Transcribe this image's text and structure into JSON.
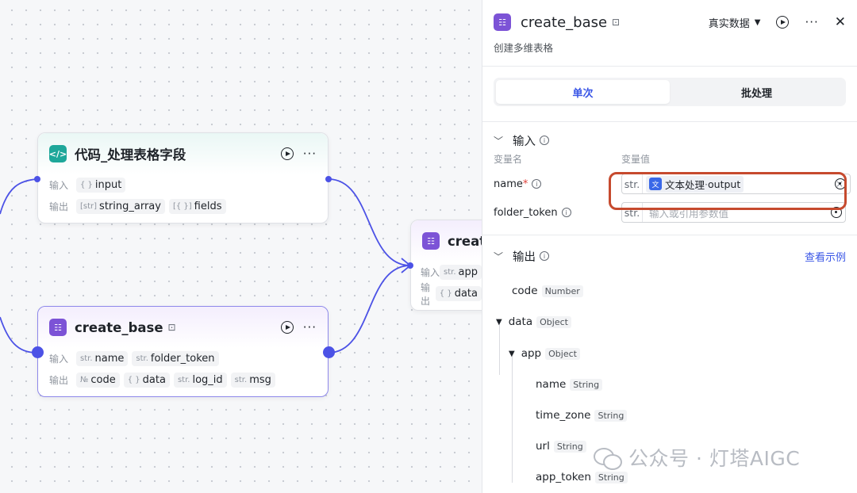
{
  "nodes": {
    "code": {
      "title": "代码_处理表格字段",
      "input_label": "输入",
      "output_label": "输出",
      "inputs": [
        {
          "type": "{ }",
          "name": "input"
        }
      ],
      "outputs": [
        {
          "type": "[str]",
          "name": "string_array"
        },
        {
          "type": "[{ }]",
          "name": "fields"
        }
      ]
    },
    "base": {
      "title": "create_base",
      "input_label": "输入",
      "output_label": "输出",
      "inputs": [
        {
          "type": "str.",
          "name": "name"
        },
        {
          "type": "str.",
          "name": "folder_token"
        }
      ],
      "outputs": [
        {
          "type": "№",
          "name": "code"
        },
        {
          "type": "{ }",
          "name": "data"
        },
        {
          "type": "str.",
          "name": "log_id"
        },
        {
          "type": "str.",
          "name": "msg"
        }
      ]
    },
    "partial": {
      "title": "create",
      "input_label": "输入",
      "output_label": "输出",
      "input_type": "str.",
      "input_name": "app",
      "output_type": "{ }",
      "output_name": "data"
    }
  },
  "panel": {
    "title": "create_base",
    "subtitle": "创建多维表格",
    "data_mode": "真实数据",
    "tabs": [
      "单次",
      "批处理"
    ],
    "input_section": "输入",
    "col_var_name": "变量名",
    "col_var_value": "变量值",
    "vars": [
      {
        "name": "name",
        "required": "*",
        "type": "str.",
        "ref_source": "文本处理",
        "ref_sep": " · ",
        "ref_field": "output",
        "clear": "×"
      },
      {
        "name": "folder_token",
        "required": "",
        "type": "str.",
        "placeholder": "输入或引用参数值"
      }
    ],
    "output_section": "输出",
    "view_example": "查看示例",
    "tree": [
      {
        "name": "code",
        "type": "Number"
      },
      {
        "name": "data",
        "type": "Object"
      },
      {
        "name": "app",
        "type": "Object"
      },
      {
        "name": "name",
        "type": "String"
      },
      {
        "name": "time_zone",
        "type": "String"
      },
      {
        "name": "url",
        "type": "String"
      },
      {
        "name": "app_token",
        "type": "String"
      }
    ]
  },
  "watermark": {
    "text": "公众号 · 灯塔AIGC"
  },
  "colors": {
    "accent": "#3a56e6",
    "port": "#4c52e6",
    "highlight": "#c64a2e",
    "code_icon": "#1ea79a",
    "base_icon": "#7c53d6"
  }
}
